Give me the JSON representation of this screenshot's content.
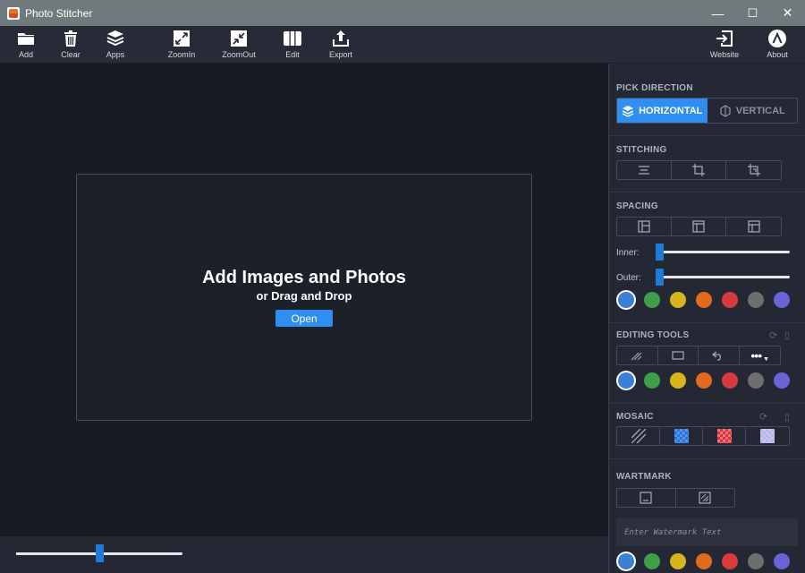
{
  "window": {
    "title": "Photo Stitcher",
    "minimize": "—",
    "maximize": "☐",
    "close": "✕"
  },
  "toolbar": {
    "add": "Add",
    "clear": "Clear",
    "apps": "Apps",
    "zoomin": "ZoomIn",
    "zoomout": "ZoomOut",
    "edit": "Edit",
    "export": "Export",
    "website": "Website",
    "about": "About"
  },
  "canvas": {
    "title": "Add Images and Photos",
    "subtitle": "or Drag and Drop",
    "open_label": "Open"
  },
  "zoom": {
    "value_percent": 50
  },
  "panel": {
    "pick_direction": {
      "title": "PICK DIRECTION",
      "horizontal": "HORIZONTAL",
      "vertical": "VERTICAL",
      "selected": "horizontal"
    },
    "stitching": {
      "title": "STITCHING"
    },
    "spacing": {
      "title": "SPACING",
      "inner_label": "Inner:",
      "outer_label": "Outer:",
      "inner_value": 0,
      "outer_value": 0
    },
    "editing_tools": {
      "title": "EDITING TOOLS"
    },
    "mosaic": {
      "title": "MOSAIC"
    },
    "watermark": {
      "title": "WARTMARK",
      "placeholder": "Enter Watermark Text"
    },
    "colors": [
      "#3d7fd4",
      "#3e9e4a",
      "#d8b51c",
      "#e06b1e",
      "#d83a3f",
      "#6e6e6e",
      "#6a63d8"
    ]
  }
}
